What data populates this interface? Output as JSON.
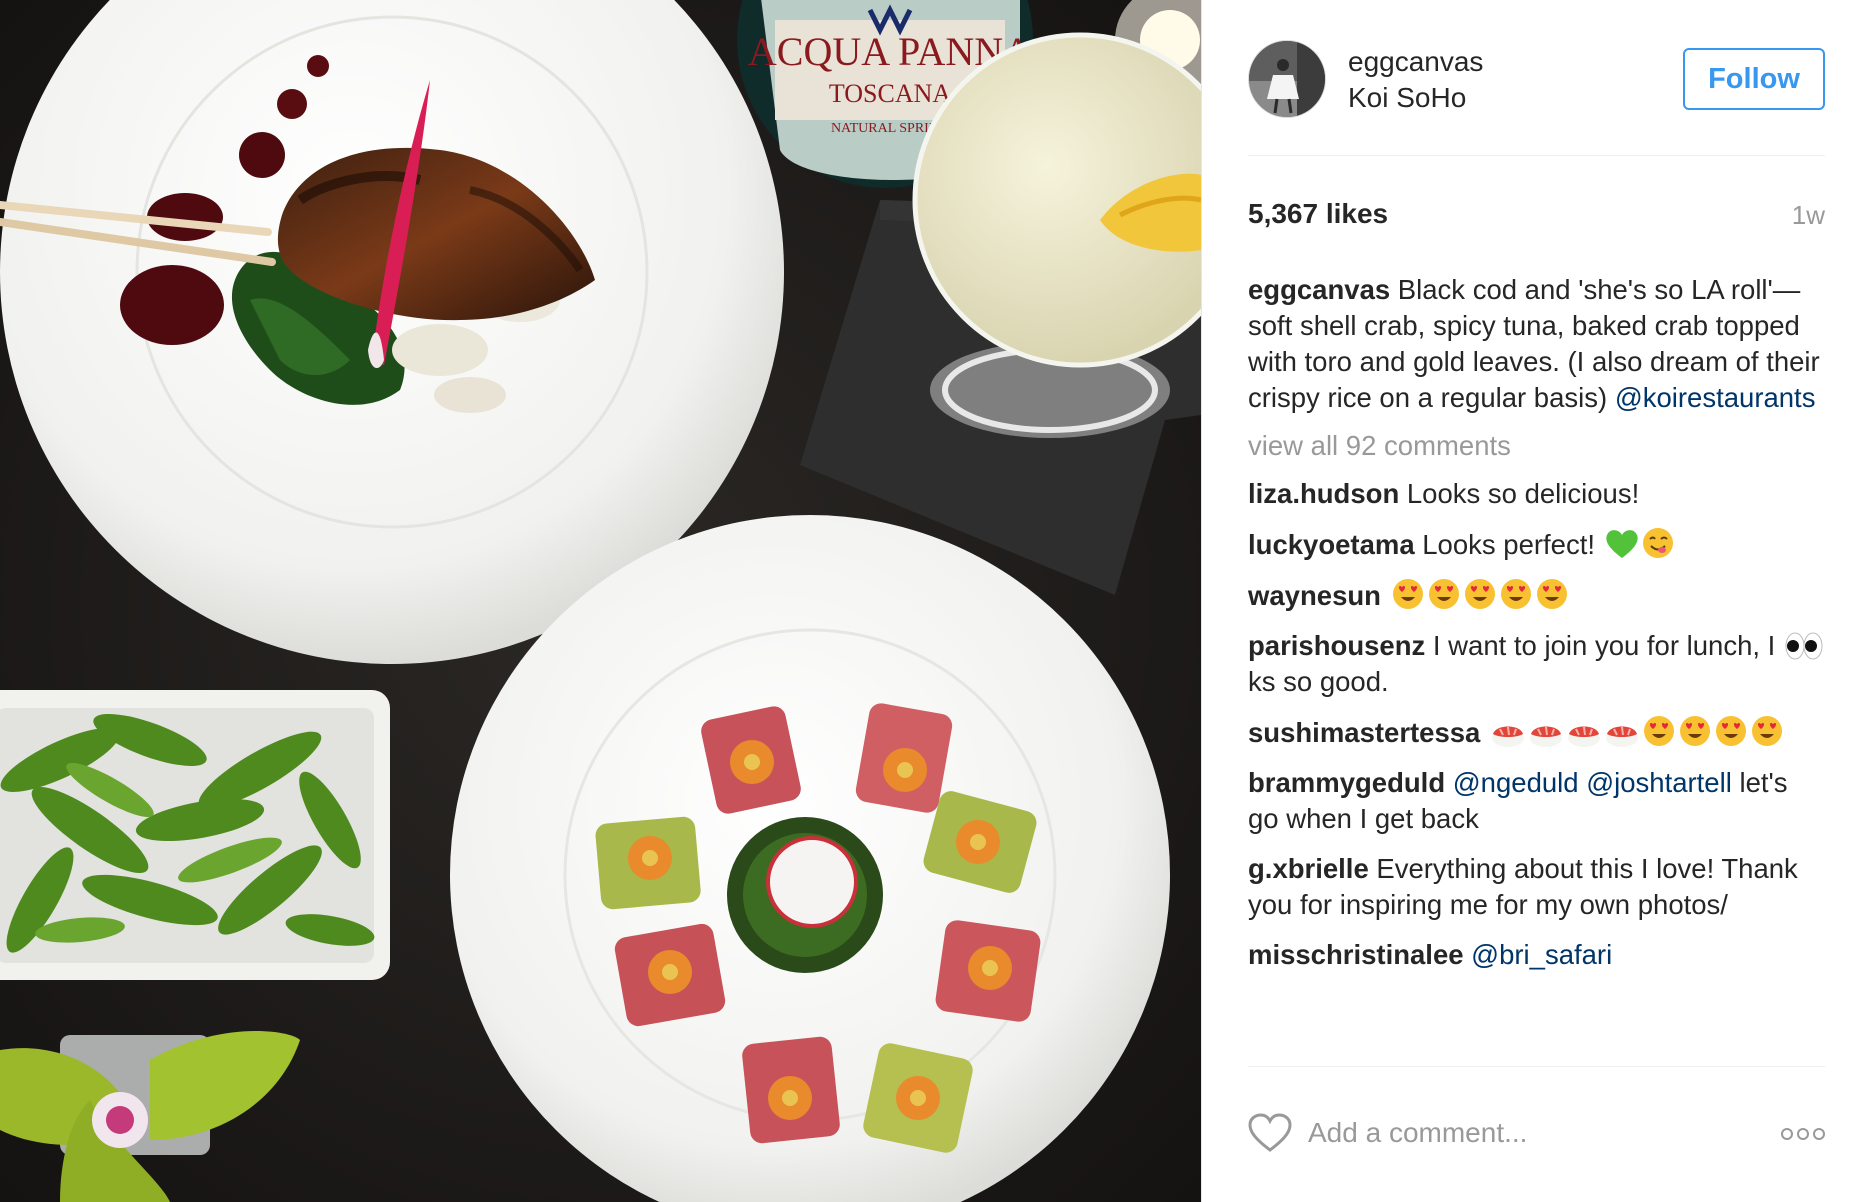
{
  "post": {
    "username": "eggcanvas",
    "location": "Koi SoHo",
    "follow_label": "Follow",
    "likes": "5,367 likes",
    "time_ago": "1w"
  },
  "caption": {
    "username": "eggcanvas",
    "text": " Black cod and 'she's so LA roll'—soft shell crab, spicy tuna, baked crab topped with toro and gold leaves. (I also dream of their crispy rice on a regular basis) ",
    "mention": "@koirestaurants"
  },
  "view_all_label": "view all 92 comments",
  "comments": [
    {
      "username": "liza.hudson",
      "text": " Looks so delicious!"
    },
    {
      "username": "luckyoetama",
      "text": " Looks perfect! ",
      "emojis": [
        "green-heart",
        "yum-face"
      ]
    },
    {
      "username": "waynesun",
      "text": " ",
      "emojis": [
        "heart-eyes",
        "heart-eyes",
        "heart-eyes",
        "heart-eyes",
        "heart-eyes"
      ]
    },
    {
      "username": "parishousenz",
      "text_before": " I want to join you for lunch, I ",
      "text_after": "ks so good.",
      "emojis": [
        "eyes"
      ]
    },
    {
      "username": "sushimastertessa",
      "text": " ",
      "emojis": [
        "sushi",
        "sushi",
        "sushi",
        "sushi",
        "heart-eyes",
        "heart-eyes",
        "heart-eyes",
        "heart-eyes"
      ]
    },
    {
      "username": "brammygeduld",
      "mentions": [
        "@ngeduld",
        "@joshtartell"
      ],
      "text": " let's go when I get back"
    },
    {
      "username": "g.xbrielle",
      "text": " Everything about this I love! Thank you for inspiring me for my own photos/"
    },
    {
      "username": "misschristinalee",
      "mentions": [
        "@bri_safari"
      ]
    }
  ],
  "footer": {
    "comment_placeholder": "Add a comment...",
    "like_icon": "heart-outline-icon",
    "more_icon": "more-options-icon"
  },
  "photo": {
    "bottle_label_top": "ACQUA PANNA",
    "bottle_label_mid": "TOSCANA",
    "bottle_label_bottom": "NATURAL SPRING"
  },
  "colors": {
    "link": "#003569",
    "follow": "#3897f0",
    "muted": "#999999",
    "text": "#262626"
  }
}
